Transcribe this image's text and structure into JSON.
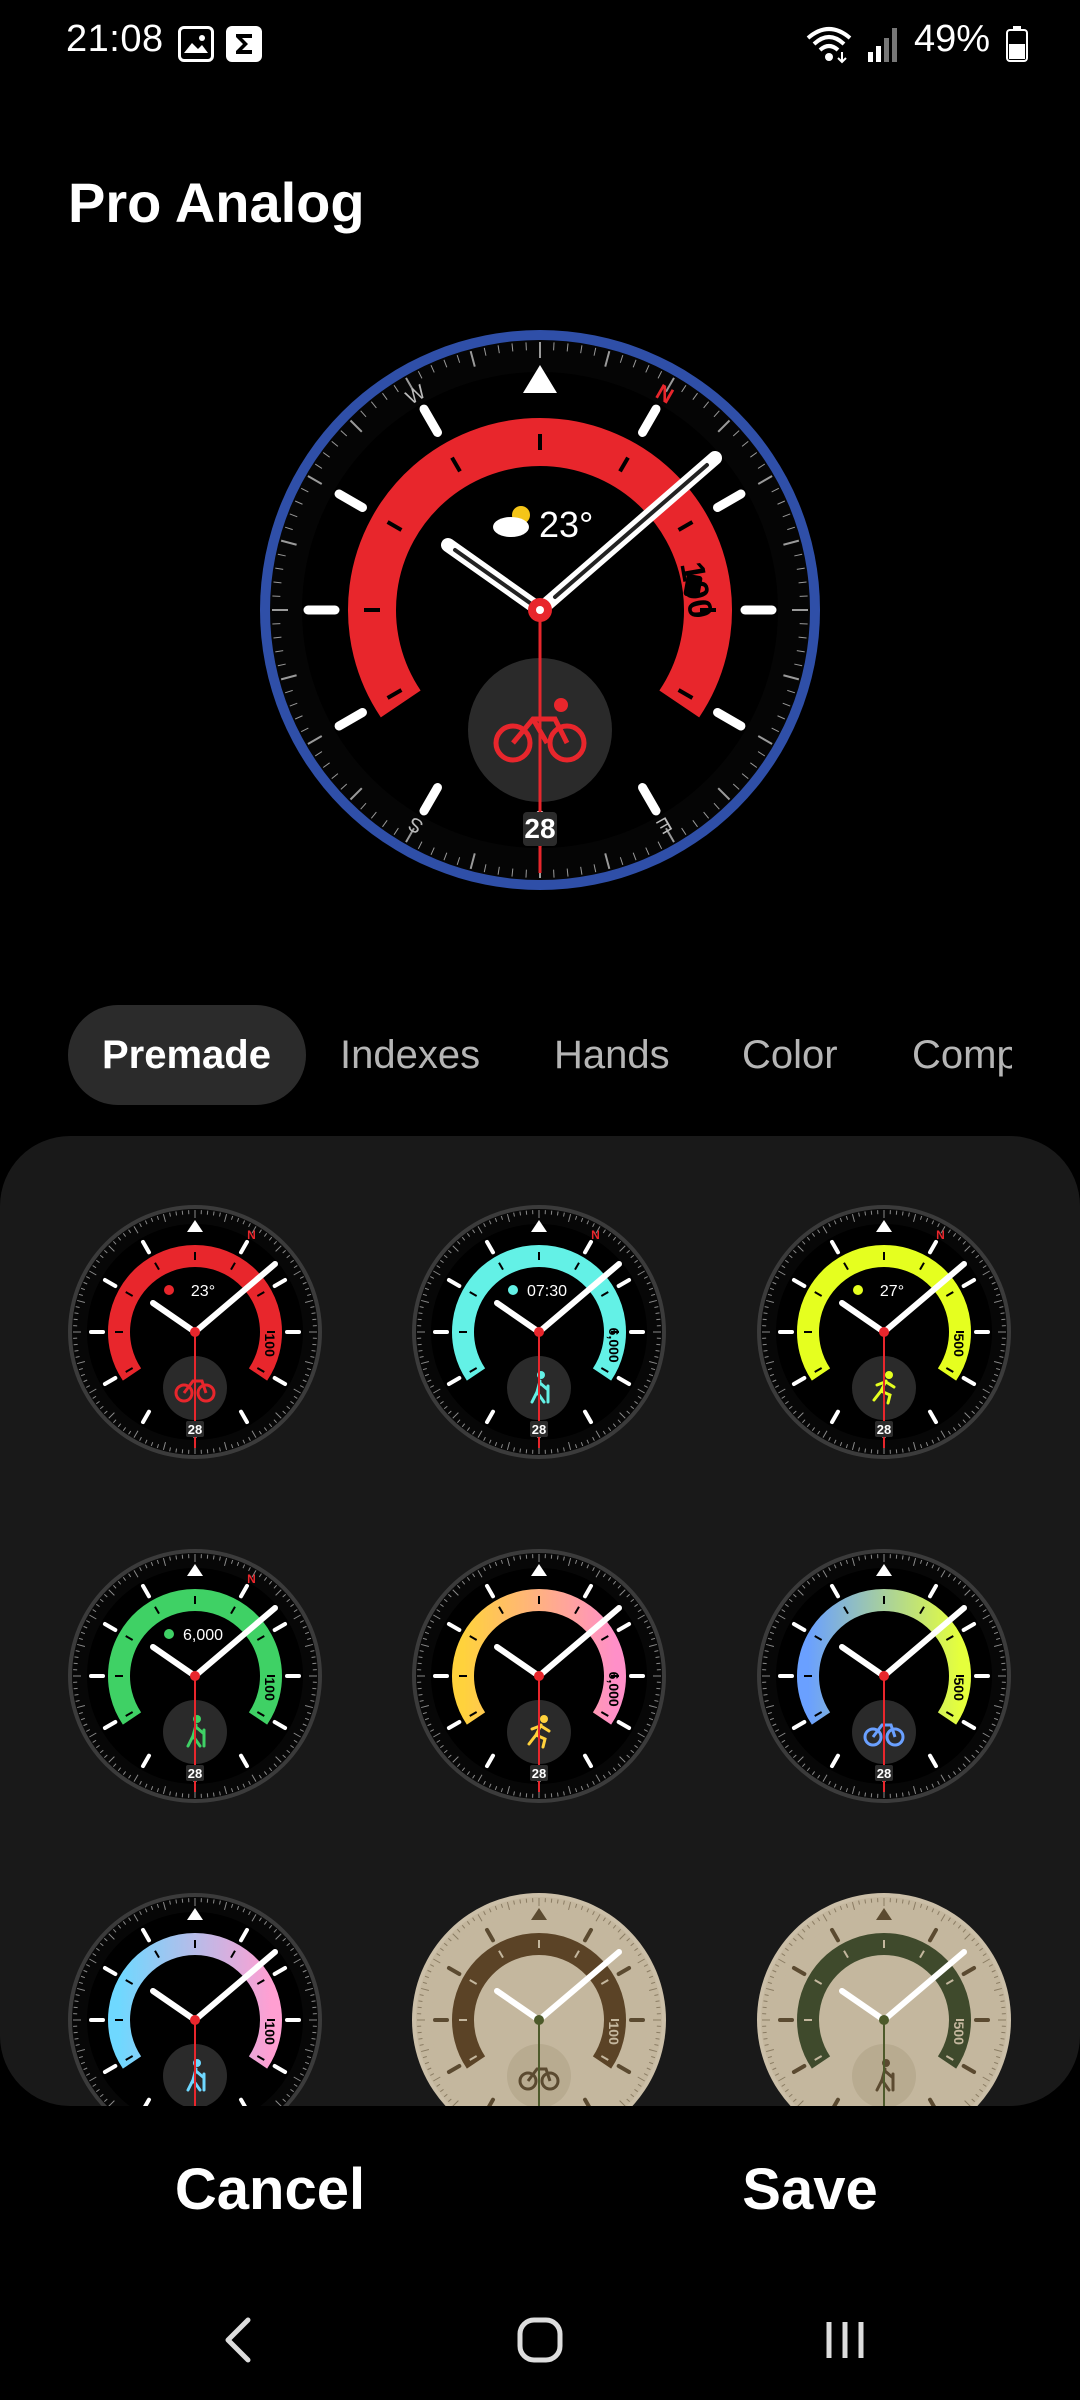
{
  "status_bar": {
    "time": "21:08",
    "battery_percent": "49%",
    "icons": [
      "image-notification-icon",
      "sigma-app-icon",
      "wifi-icon",
      "signal-icon",
      "battery-icon"
    ]
  },
  "page": {
    "title": "Pro Analog"
  },
  "preview": {
    "weather_temp": "23°",
    "gauge_value": "100",
    "date": "28",
    "compass_letters": {
      "north": "N",
      "west": "W",
      "south": "S",
      "east": "E"
    },
    "accent_color": "#e8262c",
    "bezel_color": "#2f4fa8",
    "center_icon": "bike-icon"
  },
  "tabs": [
    {
      "label": "Premade",
      "active": true
    },
    {
      "label": "Indexes",
      "active": false
    },
    {
      "label": "Hands",
      "active": false
    },
    {
      "label": "Color",
      "active": false
    },
    {
      "label": "Comp",
      "active": false
    }
  ],
  "presets": [
    {
      "top_text": "23°",
      "top_icon": "weather-icon",
      "gauge_text": "100",
      "gauge_icon": "battery-icon",
      "center_icon": "bike-icon",
      "date": "28",
      "colors": [
        "#e8262c",
        "#e8262c"
      ],
      "theme": "dark",
      "show_north": true
    },
    {
      "top_text": "07:30",
      "top_icon": "sunrise-icon",
      "gauge_text": "6,000",
      "gauge_icon": "leaf-icon",
      "center_icon": "hike-icon",
      "date": "28",
      "colors": [
        "#63f1e6",
        "#63f1e6"
      ],
      "theme": "dark",
      "show_north": true
    },
    {
      "top_text": "27°",
      "top_icon": "feels-like-icon",
      "gauge_text": "500",
      "gauge_icon": "fire-icon",
      "center_icon": "run-icon",
      "date": "28",
      "colors": [
        "#e5ff1f",
        "#e5ff1f"
      ],
      "theme": "dark",
      "show_north": true
    },
    {
      "top_text": "6,000",
      "top_icon": "steps-icon",
      "gauge_text": "100",
      "gauge_icon": "battery-icon",
      "center_icon": "hike-icon",
      "date": "28",
      "colors": [
        "#3fd165",
        "#3fd165"
      ],
      "theme": "dark",
      "show_north": true
    },
    {
      "top_text": "",
      "top_icon": "",
      "gauge_text": "6,000",
      "gauge_icon": "leaf-icon",
      "center_icon": "run-icon",
      "date": "28",
      "colors": [
        "#ffd23c",
        "#ff8fc8"
      ],
      "theme": "dark",
      "show_north": false
    },
    {
      "top_text": "",
      "top_icon": "",
      "gauge_text": "500",
      "gauge_icon": "fire-icon",
      "center_icon": "bike-icon",
      "date": "28",
      "colors": [
        "#6aa0ff",
        "#e5ff3c"
      ],
      "theme": "dark",
      "show_north": false
    },
    {
      "top_text": "",
      "top_icon": "",
      "gauge_text": "100",
      "gauge_icon": "battery-icon",
      "center_icon": "hike-icon",
      "date": "",
      "colors": [
        "#6fd8ff",
        "#ff9fd2"
      ],
      "theme": "dark",
      "show_north": false
    },
    {
      "top_text": "",
      "top_icon": "",
      "gauge_text": "100",
      "gauge_icon": "battery-icon",
      "center_icon": "bike-icon",
      "date": "",
      "colors": [
        "#5b4326",
        "#5b4326"
      ],
      "theme": "beige",
      "show_north": false
    },
    {
      "top_text": "",
      "top_icon": "",
      "gauge_text": "500",
      "gauge_icon": "fire-icon",
      "center_icon": "hike-icon",
      "date": "",
      "colors": [
        "#3f4a2c",
        "#3f4a2c"
      ],
      "theme": "beige",
      "show_north": false
    }
  ],
  "actions": {
    "cancel": "Cancel",
    "save": "Save"
  },
  "nav_bar": {
    "icons": [
      "back-icon",
      "home-icon",
      "recents-icon"
    ]
  }
}
